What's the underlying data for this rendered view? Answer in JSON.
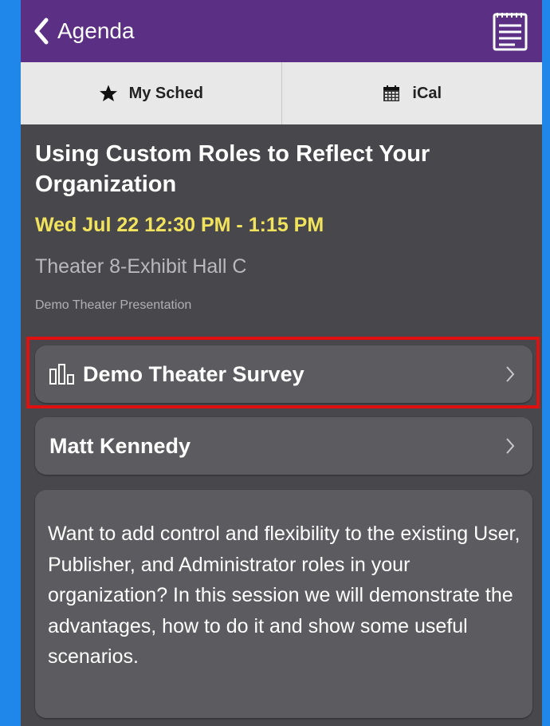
{
  "navbar": {
    "back_label": "Agenda",
    "back_icon": "chevron-left-icon",
    "notes_icon": "notepad-icon",
    "background": "#5a2f84"
  },
  "tabs": [
    {
      "label": "My Sched",
      "icon": "star-icon"
    },
    {
      "label": "iCal",
      "icon": "calendar-icon"
    }
  ],
  "session": {
    "title": "Using Custom Roles to Reflect Your Organization",
    "time": "Wed Jul 22 12:30 PM - 1:15 PM",
    "room": "Theater 8-Exhibit Hall C",
    "type": "Demo Theater Presentation"
  },
  "rows": {
    "survey": {
      "label": "Demo Theater Survey",
      "icon": "bar-chart-icon"
    },
    "speaker": {
      "label": "Matt Kennedy"
    }
  },
  "description": "Want to add control and flexibility to the existing User, Publisher, and Administrator roles in your organization? In this session we will demonstrate the advantages, how to do it and show some useful scenarios.",
  "colors": {
    "time_text": "#f2e35c",
    "highlight_box": "#e01010",
    "content_background": "#48484c"
  }
}
